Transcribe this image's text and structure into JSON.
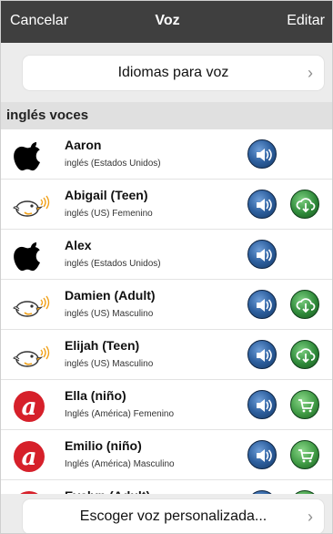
{
  "navbar": {
    "left": "Cancelar",
    "title": "Voz",
    "right": "Editar"
  },
  "languages_button": {
    "label": "Idiomas para voz",
    "chevron": "›"
  },
  "section": {
    "title": "inglés voces"
  },
  "voices": [
    {
      "name": "Aaron",
      "desc": "inglés (Estados Unidos)",
      "logo": "apple-logo-icon",
      "action": null
    },
    {
      "name": "Abigail (Teen)",
      "desc": "inglés (US) Femenino",
      "logo": "bird-logo-icon",
      "action": "download"
    },
    {
      "name": "Alex",
      "desc": "inglés (Estados Unidos)",
      "logo": "apple-logo-icon",
      "action": null
    },
    {
      "name": "Damien (Adult)",
      "desc": "inglés (US) Masculino",
      "logo": "bird-logo-icon",
      "action": "download"
    },
    {
      "name": "Elijah (Teen)",
      "desc": "inglés (US) Masculino",
      "logo": "bird-logo-icon",
      "action": "download"
    },
    {
      "name": "Ella (niño)",
      "desc": "Inglés (América) Femenino",
      "logo": "acapela-logo-icon",
      "action": "cart"
    },
    {
      "name": "Emilio (niño)",
      "desc": "Inglés (América) Masculino",
      "logo": "acapela-logo-icon",
      "action": "cart"
    },
    {
      "name": "Evelyn (Adult)",
      "desc": "",
      "logo": "acapela-logo-icon",
      "action": "cart"
    }
  ],
  "custom_voice_button": {
    "label": "Escoger voz personalizada...",
    "chevron": "›"
  }
}
